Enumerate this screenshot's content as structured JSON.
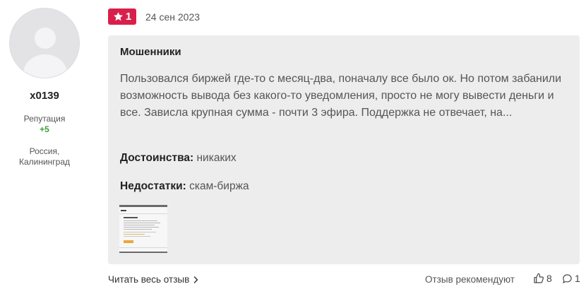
{
  "author": {
    "username": "x0139",
    "reputation_label": "Репутация",
    "reputation_value": "+5",
    "location_line1": "Россия,",
    "location_line2": "Калининград"
  },
  "review": {
    "rating": "1",
    "date": "24 сен 2023",
    "title": "Мошенники",
    "text": "Пользовался биржей где-то с месяц-два, поначалу все было ок. Но потом забанили возможность вывода без какого-то уведомления, просто не могу вывести деньги и все. Зависла крупная сумма - почти 3 эфира. Поддержка не отвечает, на...",
    "pros_label": "Достоинства:",
    "pros_value": "никаких",
    "cons_label": "Недостатки:",
    "cons_value": "скам-биржа"
  },
  "footer": {
    "read_more": "Читать весь отзыв",
    "recommend_label": "Отзыв рекомендуют",
    "likes_count": "8",
    "comments_count": "1"
  },
  "colors": {
    "badge": "#d8204a",
    "reputation": "#3ba13b",
    "card_bg": "#ededee"
  },
  "icons": {
    "star": "star-icon",
    "chevron": "chevron-right-icon",
    "thumbs_up": "thumbs-up-icon",
    "comment": "comment-icon"
  }
}
